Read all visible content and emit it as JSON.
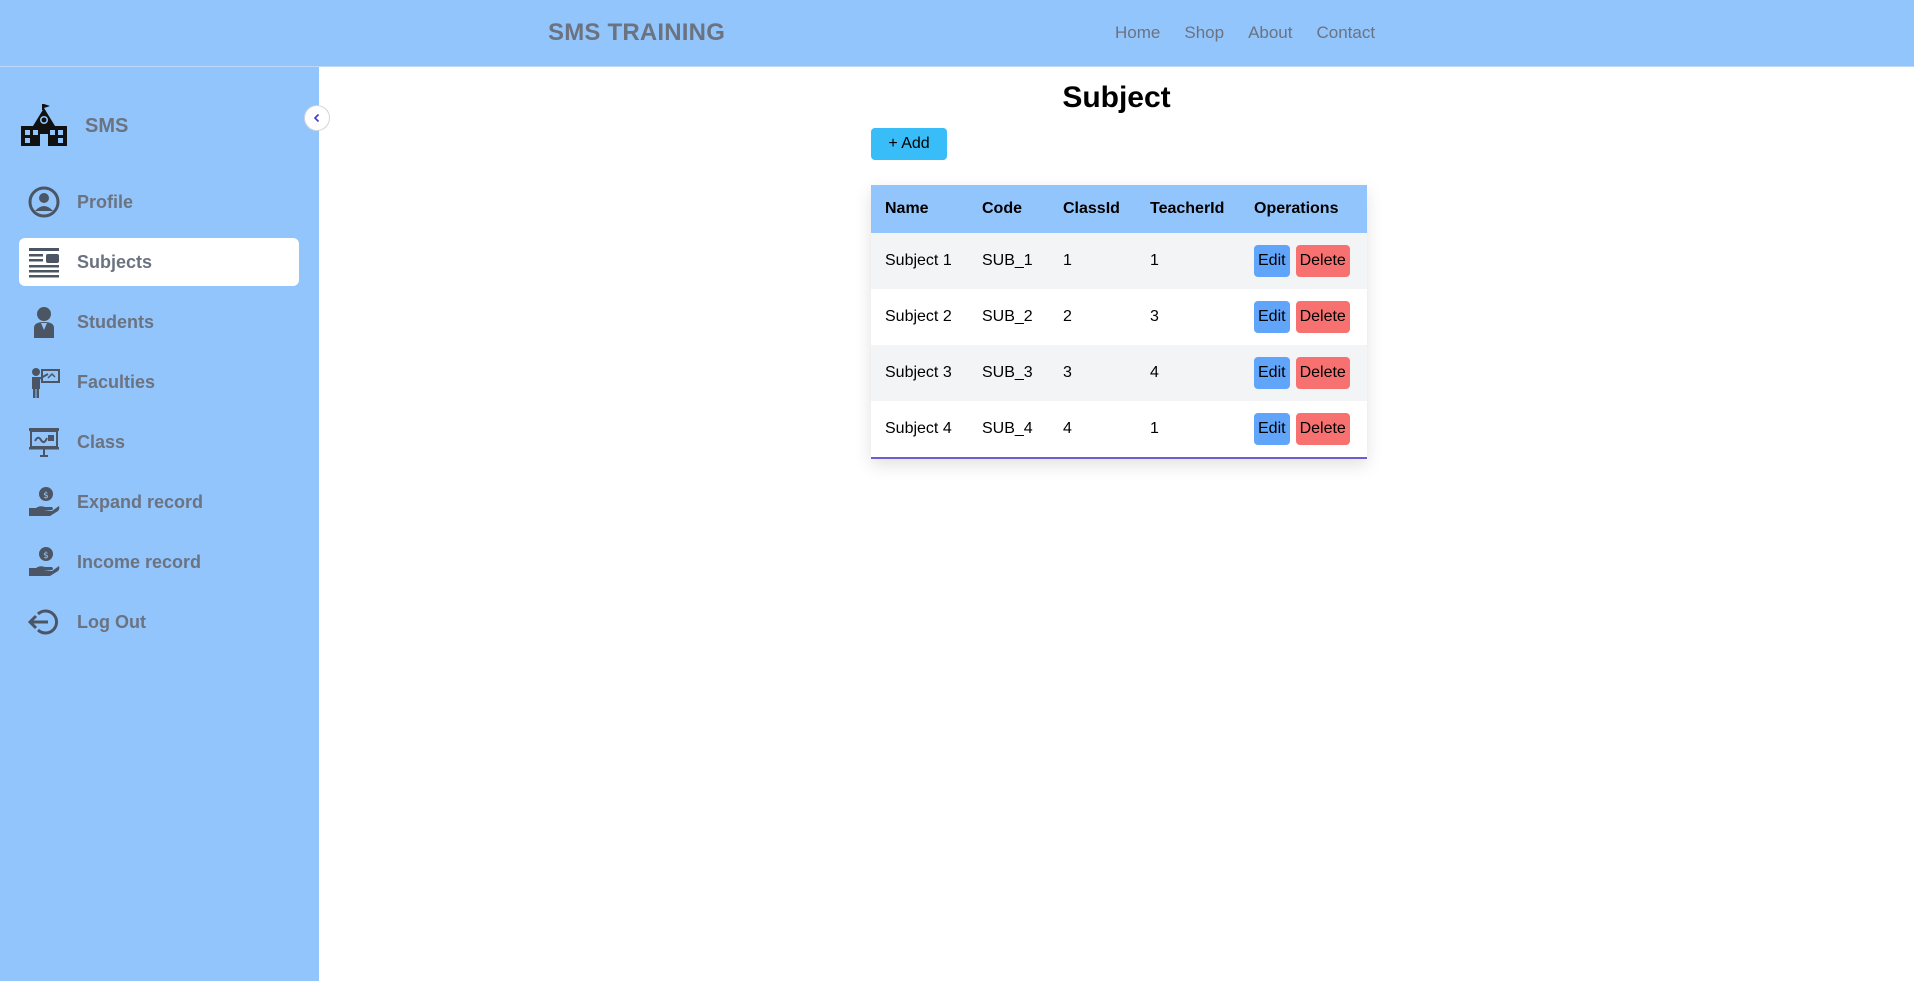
{
  "header": {
    "brand": "SMS TRAINING",
    "nav": [
      {
        "label": "Home"
      },
      {
        "label": "Shop"
      },
      {
        "label": "About"
      },
      {
        "label": "Contact"
      }
    ]
  },
  "sidebar": {
    "logo_text": "SMS",
    "items": [
      {
        "label": "Profile",
        "icon": "profile-icon"
      },
      {
        "label": "Subjects",
        "icon": "subjects-icon",
        "active": true
      },
      {
        "label": "Students",
        "icon": "student-icon"
      },
      {
        "label": "Faculties",
        "icon": "teacher-icon"
      },
      {
        "label": "Class",
        "icon": "classroom-icon"
      },
      {
        "label": "Expand record",
        "icon": "expense-icon"
      },
      {
        "label": "Income record",
        "icon": "income-icon"
      },
      {
        "label": "Log Out",
        "icon": "logout-icon"
      }
    ]
  },
  "main": {
    "title": "Subject",
    "add_label": "+ Add",
    "table": {
      "columns": [
        "Name",
        "Code",
        "ClassId",
        "TeacherId",
        "Operations"
      ],
      "rows": [
        {
          "name": "Subject 1",
          "code": "SUB_1",
          "classId": "1",
          "teacherId": "1"
        },
        {
          "name": "Subject 2",
          "code": "SUB_2",
          "classId": "2",
          "teacherId": "3"
        },
        {
          "name": "Subject 3",
          "code": "SUB_3",
          "classId": "3",
          "teacherId": "4"
        },
        {
          "name": "Subject 4",
          "code": "SUB_4",
          "classId": "4",
          "teacherId": "1"
        }
      ],
      "edit_label": "Edit",
      "delete_label": "Delete"
    }
  },
  "colors": {
    "accent": "#93c5fd",
    "add_button": "#38bdf8",
    "edit_button": "#60a5fa",
    "delete_button": "#f87171"
  }
}
